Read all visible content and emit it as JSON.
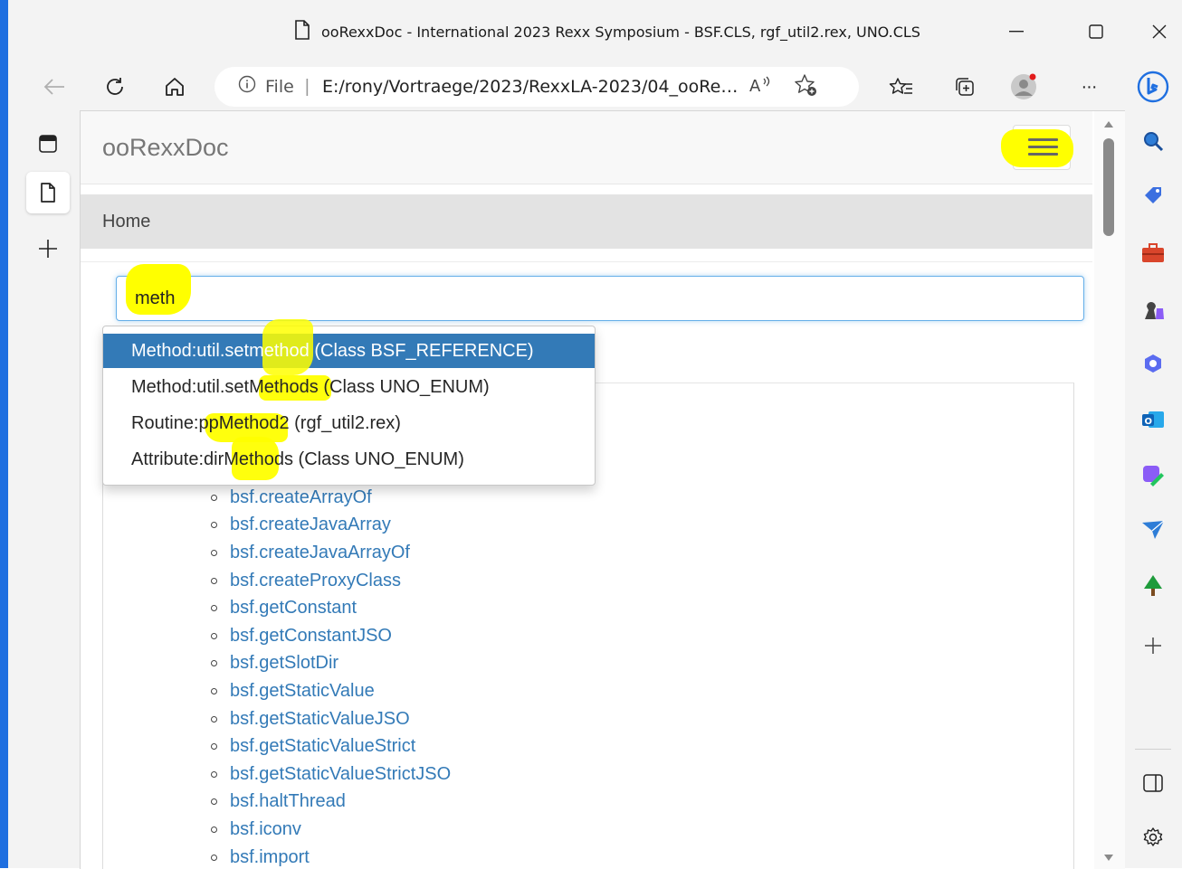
{
  "window": {
    "title": "ooRexxDoc - International 2023 Rexx Symposium - BSF.CLS, rgf_util2.rex, UNO.CLS",
    "minimize_glyph": "—",
    "maximize_glyph": "☐",
    "close_glyph": "✕"
  },
  "toolbar": {
    "url_scheme": "File",
    "url_separator": "|",
    "url": "E:/rony/Vortraege/2023/RexxLA-2023/04_ooRe…",
    "more_glyph": "···"
  },
  "page": {
    "brand": "ooRexxDoc",
    "breadcrumb_home": "Home",
    "search_value": "meth",
    "suggestions": [
      {
        "label": "Method:util.setmethod (Class BSF_REFERENCE)",
        "active": true
      },
      {
        "label": "Method:util.setMethods (Class UNO_ENUM)",
        "active": false
      },
      {
        "label": "Routine:ppMethod2 (rgf_util2.rex)",
        "active": false
      },
      {
        "label": "Attribute:dirMethods (Class UNO_ENUM)",
        "active": false
      }
    ],
    "links": [
      "bsf.createArrayOf",
      "bsf.createJavaArray",
      "bsf.createJavaArrayOf",
      "bsf.createProxyClass",
      "bsf.getConstant",
      "bsf.getConstantJSO",
      "bsf.getSlotDir",
      "bsf.getStaticValue",
      "bsf.getStaticValueJSO",
      "bsf.getStaticValueStrict",
      "bsf.getStaticValueStrictJSO",
      "bsf.haltThread",
      "bsf.iconv",
      "bsf.import"
    ]
  },
  "colors": {
    "accent_edge": "#1f6fe0",
    "link": "#337ab7",
    "highlight": "#ffff00",
    "active_suggestion": "#337ab7"
  }
}
